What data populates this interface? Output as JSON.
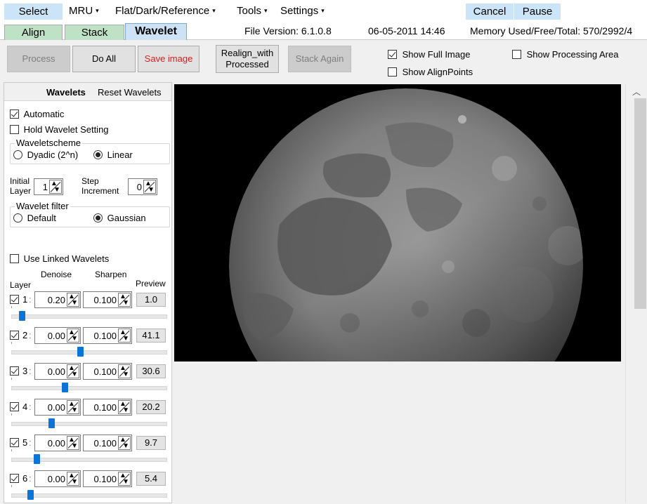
{
  "menubar": {
    "select": "Select",
    "mru": "MRU",
    "flat": "Flat/Dark/Reference",
    "tools": "Tools",
    "settings": "Settings",
    "cancel": "Cancel",
    "pause": "Pause",
    "caret": "▾"
  },
  "tabs": {
    "align": "Align",
    "stack": "Stack",
    "wavelet": "Wavelet"
  },
  "info": {
    "file_version": "File Version: 6.1.0.8",
    "datetime": "06-05-2011 14:46",
    "memory": "Memory Used/Free/Total: 570/2992/4"
  },
  "toolbar": {
    "process": "Process",
    "do_all": "Do All",
    "save_image": "Save image",
    "realign_line1": "Realign_with",
    "realign_line2": "Processed",
    "stack_again": "Stack Again",
    "show_full_image": "Show Full Image",
    "show_align_points": "Show AlignPoints",
    "show_processing_area": "Show Processing Area"
  },
  "panel": {
    "wavelets_label": "Wavelets",
    "reset_label": "Reset Wavelets",
    "automatic": "Automatic",
    "hold": "Hold Wavelet Setting",
    "scheme_title": "Waveletscheme",
    "dyadic": "Dyadic (2^n)",
    "linear": "Linear",
    "initial1": "Initial",
    "initial2": "Layer",
    "initial_value": "1",
    "step1": "Step",
    "step2": "Increment",
    "step_value": "0",
    "filter_title": "Wavelet filter",
    "default": "Default",
    "gaussian": "Gaussian",
    "use_linked": "Use Linked Wavelets",
    "col_layer": "Layer",
    "col_denoise": "Denoise",
    "col_sharpen": "Sharpen",
    "col_preview": "Preview"
  },
  "layers": [
    {
      "num": "1",
      "denoise": "0.20",
      "sharpen": "0.100",
      "preview": "1.0",
      "level": 0.05
    },
    {
      "num": "2",
      "denoise": "0.00",
      "sharpen": "0.100",
      "preview": "41.1",
      "level": 0.44
    },
    {
      "num": "3",
      "denoise": "0.00",
      "sharpen": "0.100",
      "preview": "30.6",
      "level": 0.34
    },
    {
      "num": "4",
      "denoise": "0.00",
      "sharpen": "0.100",
      "preview": "20.2",
      "level": 0.25
    },
    {
      "num": "5",
      "denoise": "0.00",
      "sharpen": "0.100",
      "preview": "9.7",
      "level": 0.15
    },
    {
      "num": "6",
      "denoise": "0.00",
      "sharpen": "0.100",
      "preview": "5.4",
      "level": 0.11
    }
  ],
  "colors": {
    "accent_blue": "#cce4f7",
    "slider_thumb": "#0a74d8",
    "tab_green": "#bfe1c5",
    "save_red": "#e01b1b"
  }
}
